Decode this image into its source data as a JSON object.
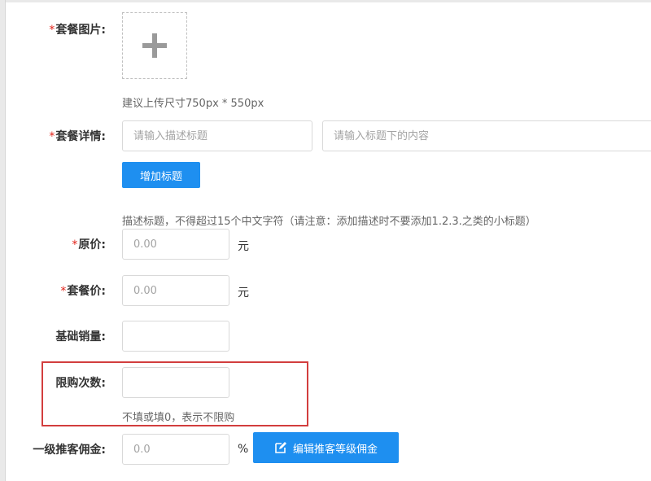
{
  "form": {
    "image": {
      "required_mark": "*",
      "label": "套餐图片:",
      "hint": "建议上传尺寸750px * 550px",
      "icon": "plus-icon"
    },
    "details": {
      "required_mark": "*",
      "label": "套餐详情:",
      "title_placeholder": "请输入描述标题",
      "content_placeholder": "请输入标题下的内容",
      "add_button": "增加标题",
      "hint": "描述标题，不得超过15个中文字符（请注意：添加描述时不要添加1.2.3.之类的小标题）"
    },
    "original_price": {
      "required_mark": "*",
      "label": "原价:",
      "placeholder": "0.00",
      "unit": "元"
    },
    "package_price": {
      "required_mark": "*",
      "label": "套餐价:",
      "placeholder": "0.00",
      "unit": "元"
    },
    "base_sales": {
      "label": "基础销量:",
      "value": ""
    },
    "purchase_limit": {
      "label": "限购次数:",
      "value": "",
      "hint": "不填或填0，表示不限购"
    },
    "commission": {
      "label": "一级推客佣金:",
      "placeholder": "0.0",
      "unit": "%",
      "edit_button": "编辑推客等级佣金",
      "icon": "edit-icon"
    }
  },
  "colors": {
    "primary": "#1e8ff0",
    "required": "#e2231a",
    "highlight": "#d23e3e"
  }
}
